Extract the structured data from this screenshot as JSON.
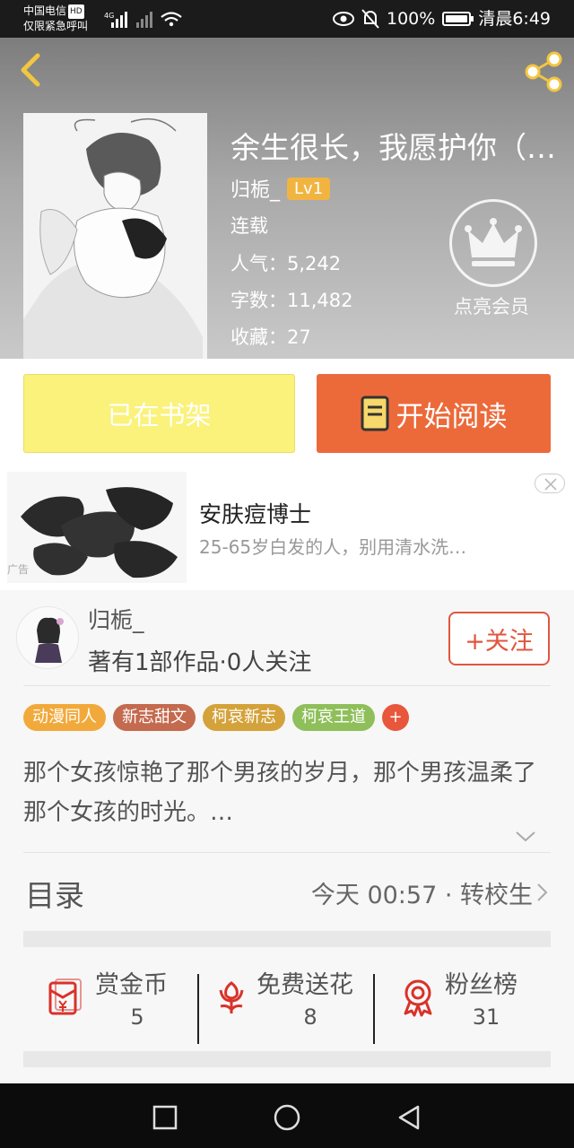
{
  "status_bar": {
    "carrier": "中国电信",
    "hd_badge": "HD",
    "carrier_sub": "仅限紧急呼叫",
    "network": "4G",
    "battery": "100%",
    "time": "清晨6:49"
  },
  "book": {
    "title": "余生很长，我愿护你（…",
    "author": "归栀_",
    "level": "Lv1",
    "status": "连载",
    "popularity": "人气：5,242",
    "word_count": "字数：11,482",
    "favorites": "收藏：27"
  },
  "vip": {
    "label": "点亮会员"
  },
  "actions": {
    "shelf_label": "已在书架",
    "read_label": "开始阅读"
  },
  "ad": {
    "title": "安肤痘博士",
    "description": "25-65岁白发的人，别用清水洗…",
    "tag": "广告"
  },
  "author_card": {
    "name": "归栀_",
    "works": "著有1部作品·0人关注",
    "follow_label": "+关注"
  },
  "tags": [
    {
      "label": "动漫同人",
      "color": "#f2a93b"
    },
    {
      "label": "新志甜文",
      "color": "#c46a4e"
    },
    {
      "label": "柯哀新志",
      "color": "#d4a23a"
    },
    {
      "label": "柯哀王道",
      "color": "#8fbf5a"
    }
  ],
  "tag_plus": "+",
  "description": "那个女孩惊艳了那个男孩的岁月，那个男孩温柔了那个女孩的时光。…",
  "toc": {
    "label": "目录",
    "latest": "今天 00:57 · 转校生"
  },
  "stats": [
    {
      "label": "赏金币",
      "value": "5",
      "icon": "red-envelope-icon"
    },
    {
      "label": "免费送花",
      "value": "8",
      "icon": "flower-icon"
    },
    {
      "label": "粉丝榜",
      "value": "31",
      "icon": "medal-icon"
    }
  ],
  "colors": {
    "accent": "#ec6a3a",
    "shelf": "#faf27b",
    "follow": "#e0563e"
  }
}
